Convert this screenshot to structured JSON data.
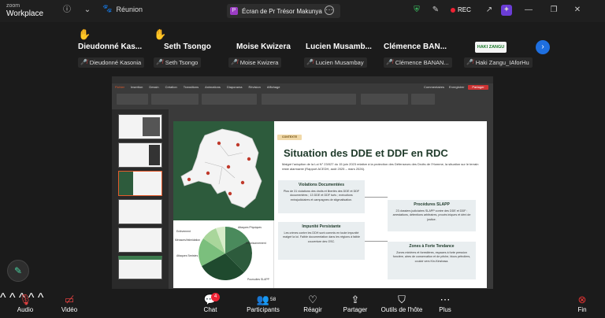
{
  "app": {
    "brand_line1": "zoom",
    "brand_line2": "Workplace",
    "meeting_label": "Réunion",
    "share_tab_label": "Écran de Pr Trésor Makunya",
    "rec_label": "REC"
  },
  "participants": [
    {
      "name": "Dieudonné Kas...",
      "label": "Dieudonné Kasonia",
      "hand": true
    },
    {
      "name": "Seth Tsongo",
      "label": "Seth Tsongo",
      "hand": true
    },
    {
      "name": "Moise Kwizera",
      "label": "Moise Kwizera",
      "hand": false
    },
    {
      "name": "Lucien Musamb...",
      "label": "Lucien Musambay",
      "hand": false
    },
    {
      "name": "Clémence BAN...",
      "label": "Clémence BANAN...",
      "hand": false
    },
    {
      "name": "",
      "label": "Haki Zangu_IAforHu",
      "hand": false
    }
  ],
  "logo_tile_text": "HAKI ZANGU",
  "slide": {
    "badge": "CONTEXTE",
    "title": "Situation des DDE et DDF en RDC",
    "intro": "Malgré l'adoption de la Loi N° 23/027 du 15 juin 2023 relative à la protection des Défenseurs des Droits de l'Homme, la situation sur le terrain reste alarmante (Rapport ACEDH, août 2025 – mars 2026).",
    "cards": [
      {
        "title": "Violations Documentées",
        "body": "Plus de 31 violations des droits et libertés des DDE et DDF documentées ; 13 DDE et DDF tués ; exécutions extrajudiciaires et campagnes de stigmatisation."
      },
      {
        "title": "Impunité Persistante",
        "body": "Les crimes contre les DDH sont commis en toute impunité malgré la loi. Faible documentation dans les régions à faible couverture des OSC."
      },
      {
        "title": "Procédures SLAPP",
        "body": "23 dossiers judiciaires SLAPP contre des DDE et DDF : arrestations, détentions arbitraires, procès iniques et déni de justice."
      },
      {
        "title": "Zones à Forte Tendance",
        "body": "Zones minières et forestières, espaces à forte pression foncière, aires de conservation et de pêche, blocs pétroliers, couloir vers Kin-Kinshasa."
      }
    ],
    "pie_labels": [
      "Enlèvement",
      "Menaces/Intimidation",
      "Attaques Sexistes",
      "Attaques Physiques",
      "Emprisonnement",
      "Poursuites SLAPP"
    ]
  },
  "ppt": {
    "tabs": [
      "Fichier",
      "Insertion",
      "Dessin",
      "Création",
      "Transitions",
      "Animations",
      "Diaporama",
      "Révision",
      "Affichage"
    ],
    "comments_label": "Commentaires",
    "record_label": "Enregistrer",
    "share_label": "Partager"
  },
  "toolbar": {
    "audio": "Audio",
    "video": "Vidéo",
    "chat": "Chat",
    "chat_badge": "4",
    "participants": "Participants",
    "participants_count": "58",
    "react": "Réagir",
    "share": "Partager",
    "host_tools": "Outils de l'hôte",
    "more": "Plus",
    "end": "Fin"
  },
  "colors": {
    "accent_blue": "#1e6fe0",
    "end_red": "#e23333",
    "slide_green": "#2d5b3c"
  }
}
